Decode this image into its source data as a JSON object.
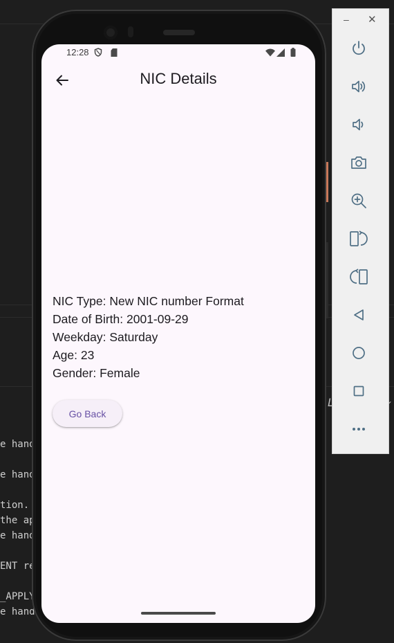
{
  "background_editor": {
    "code_fragments": [
      "e hand",
      "e hand",
      "tion.",
      "the ap",
      "e hand",
      "ENT re",
      "_APPLY",
      "e hand"
    ],
    "gutter_text": "L",
    "gutter_chevron": "⌄"
  },
  "status_bar": {
    "time": "12:28"
  },
  "app_bar": {
    "title": "NIC Details",
    "back_icon": "arrow-left-icon"
  },
  "details": {
    "nic_type": "NIC Type: New NIC number Format",
    "date_of_birth": "Date of Birth: 2001-09-29",
    "weekday": "Weekday: Saturday",
    "age": "Age: 23",
    "gender": "Gender: Female"
  },
  "actions": {
    "go_back_label": "Go Back"
  },
  "emulator_toolbar": {
    "minimize": "–",
    "close": "✕",
    "tools": [
      "power-icon",
      "volume-up-icon",
      "volume-down-icon",
      "camera-icon",
      "zoom-in-icon",
      "rotate-left-icon",
      "rotate-right-icon",
      "back-icon",
      "home-icon",
      "overview-icon",
      "more-icon"
    ]
  },
  "colors": {
    "screen_background": "#fdf7fd",
    "primary": "#6750a4",
    "text": "#1d1b20",
    "button_surface": "#f6eff8",
    "toolbar_background": "#f0f0f0",
    "toolbar_icon": "#4f6f85"
  }
}
